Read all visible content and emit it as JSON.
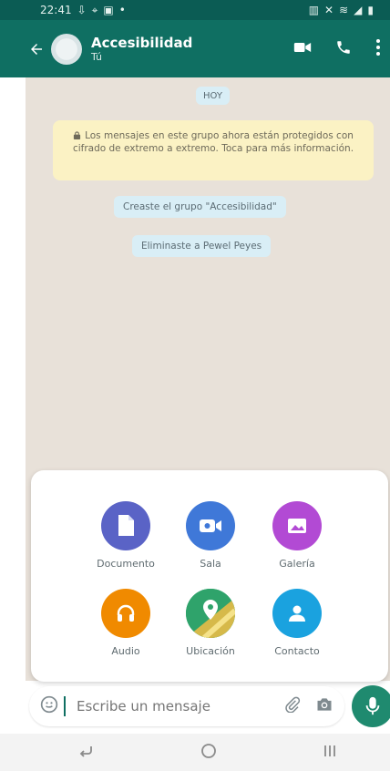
{
  "status_bar": {
    "time": "22:41",
    "left_icons": [
      "notification-icon",
      "location-icon",
      "gallery-icon",
      "dot-icon"
    ],
    "right_icons": [
      "sim-icon",
      "mute-icon",
      "wifi-icon",
      "signal-icon",
      "battery-icon"
    ]
  },
  "header": {
    "title": "Accesibilidad",
    "subtitle": "Tú",
    "actions": [
      "video-call-icon",
      "phone-icon",
      "more-options-icon"
    ]
  },
  "chat": {
    "date_chip": "HOY",
    "encryption_notice": "Los mensajes en este grupo ahora están protegidos con cifrado de extremo a extremo. Toca para más información.",
    "system_messages": [
      "Creaste el grupo \"Accesibilidad\"",
      "Eliminaste a Pewel Peyes"
    ]
  },
  "attach_menu": {
    "items": [
      {
        "label": "Documento",
        "icon": "document-icon",
        "color": "#5a63c6"
      },
      {
        "label": "Sala",
        "icon": "video-room-icon",
        "color": "#3f78d8"
      },
      {
        "label": "Galería",
        "icon": "gallery-icon",
        "color": "#b24ad4"
      },
      {
        "label": "Audio",
        "icon": "headphones-icon",
        "color": "#f08a00"
      },
      {
        "label": "Ubicación",
        "icon": "location-map-icon",
        "color": "#2fa36b"
      },
      {
        "label": "Contacto",
        "icon": "contact-icon",
        "color": "#1aa2df"
      }
    ]
  },
  "composer": {
    "placeholder": "Escribe un mensaje",
    "left_icon": "emoji-icon",
    "right_icons": [
      "attach-icon",
      "camera-icon"
    ],
    "send_icon": "mic-icon"
  },
  "nav_bar": {
    "icons": [
      "back-nav-icon",
      "home-nav-icon",
      "recents-nav-icon"
    ]
  },
  "colors": {
    "brand": "#0f6f62",
    "chat_bg": "#e8e1d9",
    "notice_bg": "#fbf2c4",
    "chip_bg": "#d9eef6",
    "mic": "#1f8a6f"
  }
}
